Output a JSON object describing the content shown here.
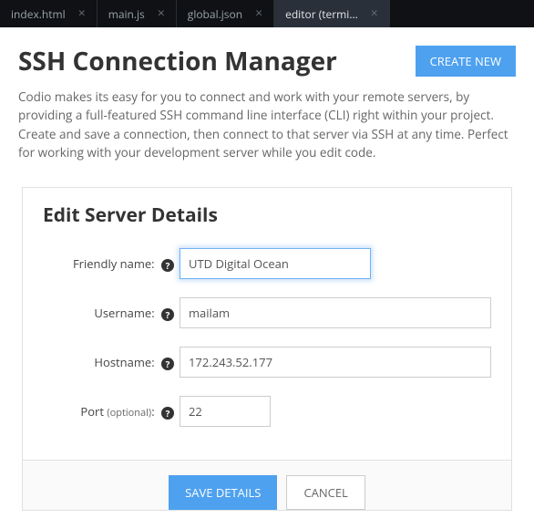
{
  "tabs": [
    {
      "label": "index.html",
      "active": false
    },
    {
      "label": "main.js",
      "active": false
    },
    {
      "label": "global.json",
      "active": false
    },
    {
      "label": "editor (termi...",
      "active": true
    }
  ],
  "header": {
    "title": "SSH Connection Manager",
    "create_button": "CREATE NEW"
  },
  "intro": "Codio makes its easy for you to connect and work with your remote servers, by providing a full-featured SSH command line interface (CLI) right within your project. Create and save a connection, then connect to that server via SSH at any time. Perfect for working with your development server while you edit code.",
  "card": {
    "title": "Edit Server Details",
    "fields": {
      "friendly": {
        "label": "Friendly name:",
        "value": "UTD Digital Ocean"
      },
      "username": {
        "label": "Username:",
        "value": "mailam"
      },
      "hostname": {
        "label": "Hostname:",
        "value": "172.243.52.177"
      },
      "port": {
        "label": "Port",
        "optional": "(optional)",
        "suffix": ":",
        "value": "22"
      }
    },
    "buttons": {
      "save": "SAVE DETAILS",
      "cancel": "CANCEL"
    }
  }
}
